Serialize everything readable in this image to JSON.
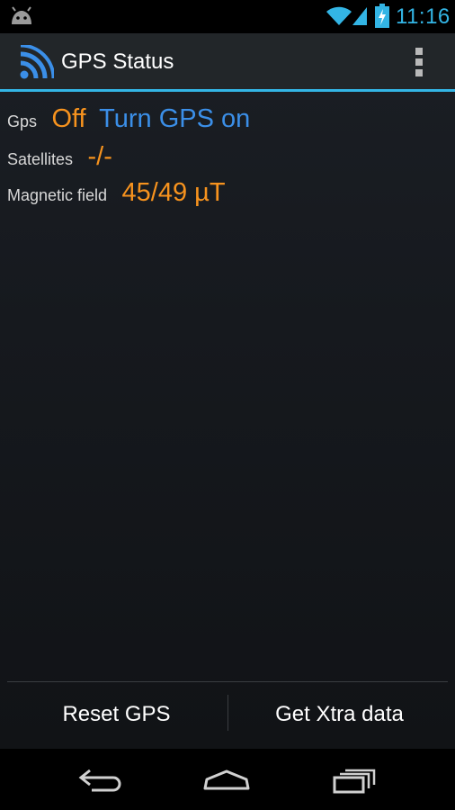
{
  "status_bar": {
    "time": "11:16",
    "icons": [
      "android-icon",
      "wifi-icon",
      "signal-icon",
      "battery-charging-icon"
    ],
    "accent_color": "#33b5e5"
  },
  "action_bar": {
    "title": "GPS Status",
    "app_icon": "gps-signal-icon",
    "overflow_icon": "overflow-menu-icon"
  },
  "info": {
    "gps": {
      "label": "Gps",
      "value": "Off",
      "action": "Turn GPS on"
    },
    "satellites": {
      "label": "Satellites",
      "value": "-/-"
    },
    "magnetic_field": {
      "label": "Magnetic field",
      "value": "45/49 µT"
    }
  },
  "buttons": {
    "reset_gps": "Reset GPS",
    "get_xtra": "Get Xtra data"
  },
  "nav_bar": {
    "icons": [
      "back-icon",
      "home-icon",
      "recent-apps-icon"
    ]
  },
  "colors": {
    "value": "#f7931e",
    "link": "#3b8fe8",
    "label": "#d8d8d8",
    "accent": "#33b5e5"
  }
}
